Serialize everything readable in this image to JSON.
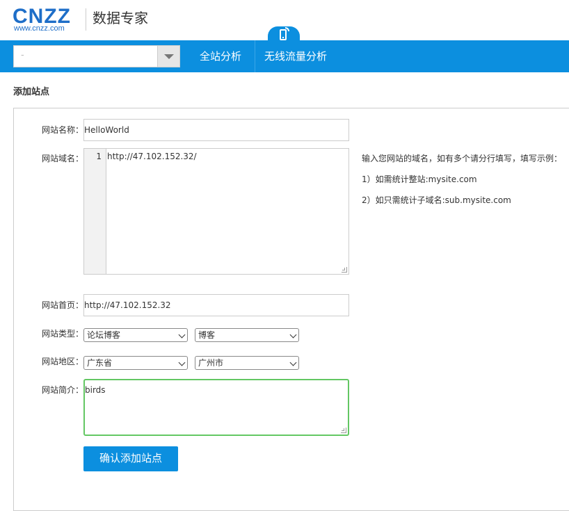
{
  "header": {
    "logo_text": "CNZZ",
    "logo_url": "www.cnzz.com",
    "product_name": "数据专家"
  },
  "navbar": {
    "site_selector": {
      "value": "-"
    },
    "items": [
      {
        "label": "全站分析"
      },
      {
        "label": "无线流量分析"
      }
    ]
  },
  "page": {
    "title": "添加站点"
  },
  "form": {
    "site_name": {
      "label": "网站名称：",
      "value": "HelloWorld"
    },
    "site_domain": {
      "label": "网站域名：",
      "line_number": "1",
      "value": "http://47.102.152.32/"
    },
    "hints": [
      "输入您网站的域名，如有多个请分行填写，填写示例：",
      "1）如需统计整站:mysite.com",
      "2）如只需统计子域名:sub.mysite.com"
    ],
    "site_homepage": {
      "label": "网站首页：",
      "value": "http://47.102.152.32"
    },
    "site_type": {
      "label": "网站类型：",
      "primary": "论坛博客",
      "secondary": "博客"
    },
    "site_region": {
      "label": "网站地区：",
      "province": "广东省",
      "city": "广州市"
    },
    "site_intro": {
      "label": "网站简介：",
      "value": "birds"
    },
    "submit_label": "确认添加站点"
  },
  "colors": {
    "primary_blue": "#0c8fdf",
    "focus_green": "#63c763"
  }
}
